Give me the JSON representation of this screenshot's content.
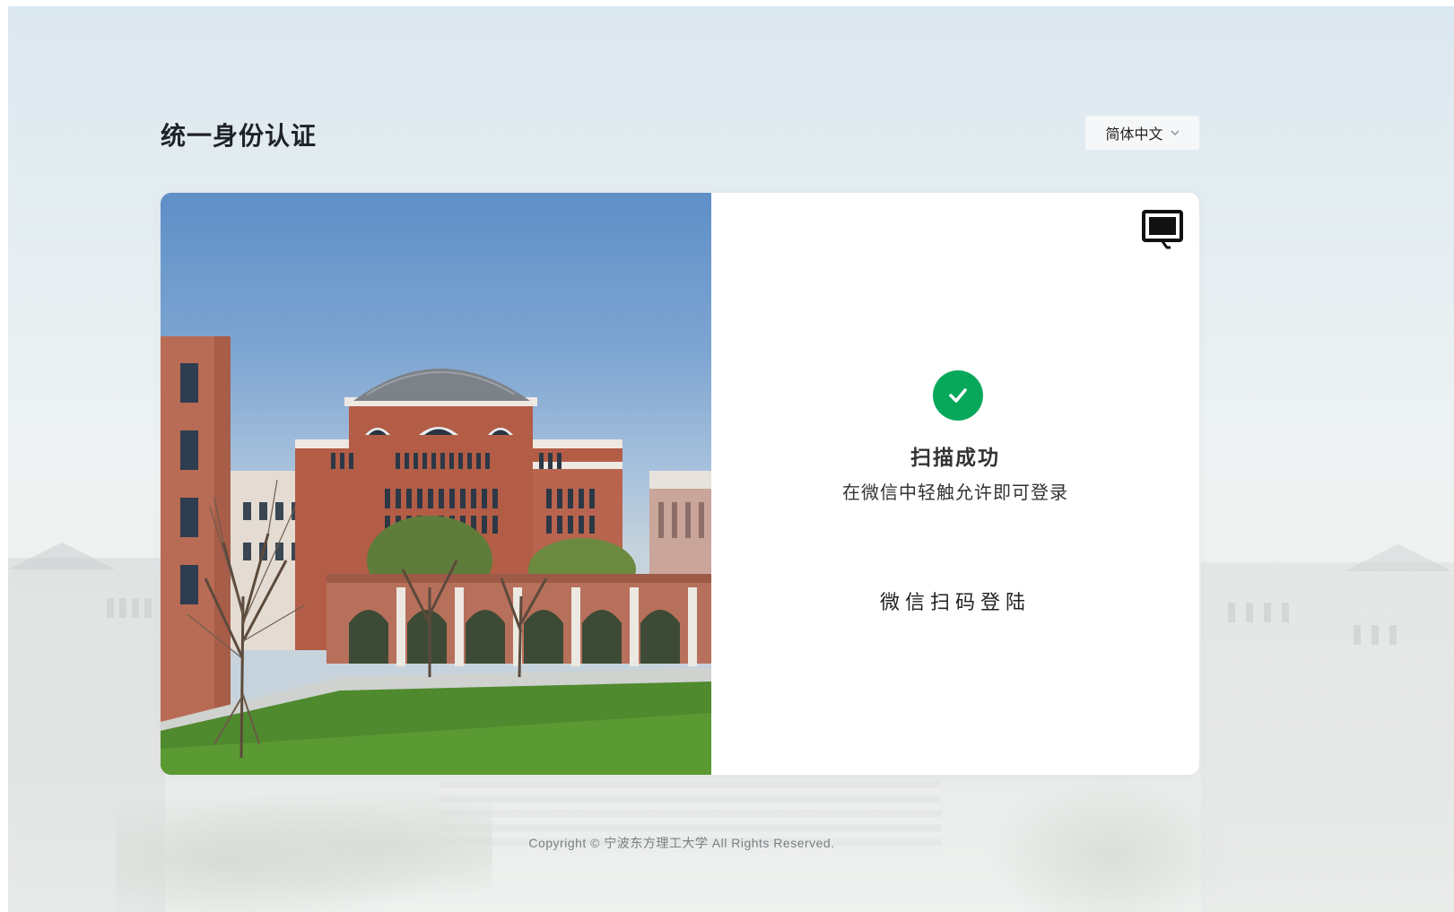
{
  "header": {
    "title": "统一身份认证",
    "language": {
      "selected": "简体中文",
      "chevron_icon": "chevron-down-icon"
    }
  },
  "login": {
    "switch_icon": "computer-monitor-icon",
    "status_icon": "check-circle-icon",
    "status_color": "#07a85a",
    "status_title": "扫描成功",
    "status_subtitle": "在微信中轻触允许即可登录",
    "method_title": "微信扫码登陆"
  },
  "footer": {
    "copyright": "Copyright © 宁波东方理工大学 All Rights Reserved."
  }
}
